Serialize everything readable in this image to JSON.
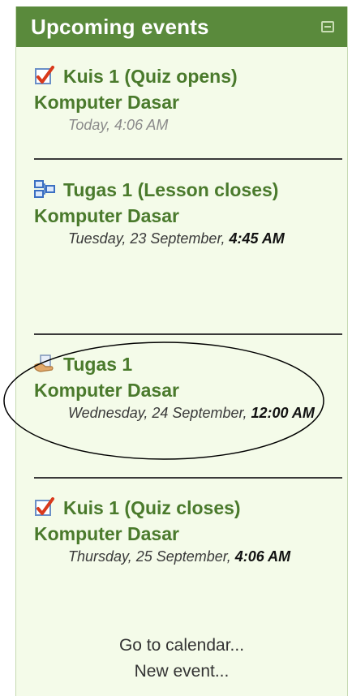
{
  "block": {
    "title": "Upcoming events",
    "collapse_icon": "minus-box-icon"
  },
  "events": [
    {
      "icon": "quiz-checkmark-icon",
      "name": "Kuis 1 (Quiz opens)",
      "course": "Komputer Dasar",
      "date": "Today, 4:06 AM"
    },
    {
      "icon": "lesson-icon",
      "name": "Tugas 1 (Lesson closes)",
      "course": "Komputer Dasar",
      "date_prefix": "Tuesday, 23 September, ",
      "time": "4:45 AM"
    },
    {
      "icon": "assignment-icon",
      "name": "Tugas 1",
      "course": "Komputer Dasar",
      "date_prefix": "Wednesday, 24 September, ",
      "time": "12:00 AM"
    },
    {
      "icon": "quiz-checkmark-icon",
      "name": "Kuis 1 (Quiz closes)",
      "course": "Komputer Dasar",
      "date_prefix": "Thursday, 25 September, ",
      "time": "4:06 AM"
    }
  ],
  "footer": {
    "calendar_link": "Go to calendar...",
    "new_event_link": "New event..."
  },
  "colors": {
    "header_bg": "#5a8a3c",
    "block_bg": "#f4fbe9",
    "link_green": "#4a7a2c"
  }
}
